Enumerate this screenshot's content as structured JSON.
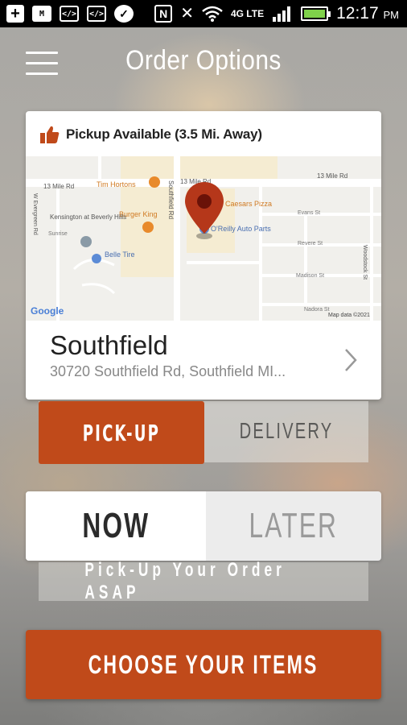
{
  "status_bar": {
    "time": "12:17",
    "ampm": "PM",
    "network": "4G LTE",
    "icons": [
      "plus-icon",
      "gmail-icon",
      "code-icon",
      "code-icon",
      "chat-icon",
      "nfc-icon",
      "mute-icon",
      "wifi-icon",
      "signal-icon",
      "battery-icon"
    ]
  },
  "header": {
    "title": "Order Options",
    "menu_icon": "hamburger-icon"
  },
  "location_card": {
    "availability": "Pickup Available (3.5 Mi. Away)",
    "thumb_icon": "thumbs-up-icon",
    "name": "Southfield",
    "address": "30720 Southfield Rd, Southfield MI...",
    "map": {
      "labels": {
        "road_13mile_left": "13 Mile Rd",
        "road_13mile_center": "13 Mile Rd",
        "road_13mile_right": "13 Mile Rd",
        "tim_hortons": "Tim Hortons",
        "caesars": "Caesars Pizza",
        "burger_king": "Burger King",
        "oreilly": "O'Reilly Auto Parts",
        "kensington": "Kensington at Beverly Hills",
        "belle_tire": "Belle Tire",
        "southfield_rd": "Southfield Rd",
        "evergreen": "W Evergreen Rd",
        "sunrise": "Sunrise",
        "evans": "Evans St",
        "revere": "Revere St",
        "madison": "Madison St",
        "nadora": "Nadora St",
        "woodstock": "Woodstock St",
        "google": "Google",
        "copyright": "Map data ©2021"
      },
      "accent_color": "#b5371a"
    }
  },
  "fulfillment": {
    "pickup_label": "PICK-UP",
    "delivery_label": "DELIVERY",
    "selected": "PICK-UP"
  },
  "timing": {
    "now_label": "NOW",
    "later_label": "LATER",
    "selected": "NOW",
    "hint": "Pick-Up Your Order ASAP"
  },
  "cta": {
    "label": "CHOOSE YOUR ITEMS"
  },
  "colors": {
    "brand": "#c04a1a",
    "pin": "#b5371a"
  }
}
